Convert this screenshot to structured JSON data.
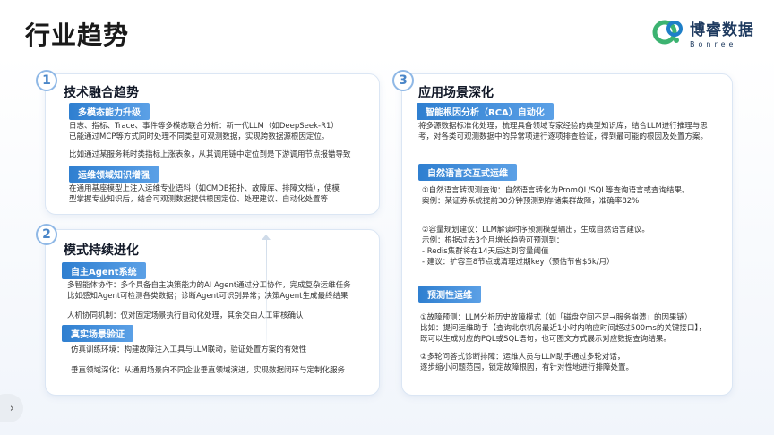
{
  "page": {
    "title": "行业趋势"
  },
  "logo": {
    "cn": "博睿数据",
    "en": "Bonree"
  },
  "cards": {
    "c1": {
      "num": "1",
      "title": "技术融合趋势",
      "tag1": "多模态能力升级",
      "t1": "日志、指标、Trace、事件等多模态联合分析：新一代LLM（如DeepSeek-R1）",
      "t2": "已能通过MCP等方式同时处理不同类型可观测数据，实现跨数据源根因定位。",
      "t3": "比如通过某服务耗时类指标上涨表象，从其调用链中定位到是下游调用节点报错导致",
      "tag2": "运维领域知识增强",
      "t4": "在通用基座模型上注入运维专业语料（如CMDB拓扑、故障库、排障文档），使模",
      "t5": "型掌握专业知识后，结合可观测数据提供根因定位、处理建议、自动化处置等"
    },
    "c2": {
      "num": "2",
      "title": "模式持续进化",
      "tag1": "自主Agent系统",
      "t1": "多智能体协作：多个具备自主决策能力的AI Agent通过分工协作，完成复杂运维任务",
      "t2": "比如感知Agent可检测各类数据；诊断Agent可识别异常；决策Agent生成最终结果",
      "t3": "人机协同机制：仅对固定场景执行自动化处理，其余交由人工审核确认",
      "tag2": "真实场景验证",
      "t4": "仿真训练环境：构建故障注入工具与LLM联动，验证处置方案的有效性",
      "t5": "垂直领域深化：从通用场景向不同企业垂直领域演进，实现数据闭环与定制化服务"
    },
    "c3": {
      "num": "3",
      "title": "应用场景深化",
      "tag1": "智能根因分析（RCA）自动化",
      "t1": "将多源数据标准化处理，梳理具备领域专家经验的典型知识库，结合LLM进行推理与思",
      "t2": "考，对各类可观测数据中的异常项进行逐项排查验证，得到最可能的根因及处置方案。",
      "tag2": "自然语言交互式运维",
      "t3": "①自然语言转观测查询：自然语言转化为PromQL/SQL等查询语言或查询结果。",
      "t4": "案例：某证券系统提前30分钟预测到存储集群故障，准确率82%",
      "t5": "②容量规划建议：LLM解读时序预测模型输出，生成自然语言建议。",
      "t6": "示例：根据过去3个月增长趋势可预测到：",
      "t7": "- Redis集群将在14天后达到容量阈值",
      "t8": "- 建议：扩容至8节点或清理过期key（预估节省$5k/月）",
      "tag3": "预测性运维",
      "t9": "①故障预测：LLM分析历史故障模式（如「磁盘空间不足→服务崩溃」的因果链）",
      "t10": "比如：提问运维助手【查询北京机房最近1小时内响应时间超过500ms的关键接口】，",
      "t11": "既可以生成对应的PQL或SQL语句，也可图文方式展示对应数据查询结果。",
      "t12": "②多轮问答式诊断排障：运维人员与LLM助手通过多轮对话，",
      "t13": "逐步缩小问题范围，锁定故障根因，有针对性地进行排障处置。"
    }
  },
  "nav": {
    "next_glyph": "›"
  },
  "colors": {
    "accent": "#2f7fd0",
    "logo_green": "#3cb371",
    "title": "#1a1a1a"
  }
}
